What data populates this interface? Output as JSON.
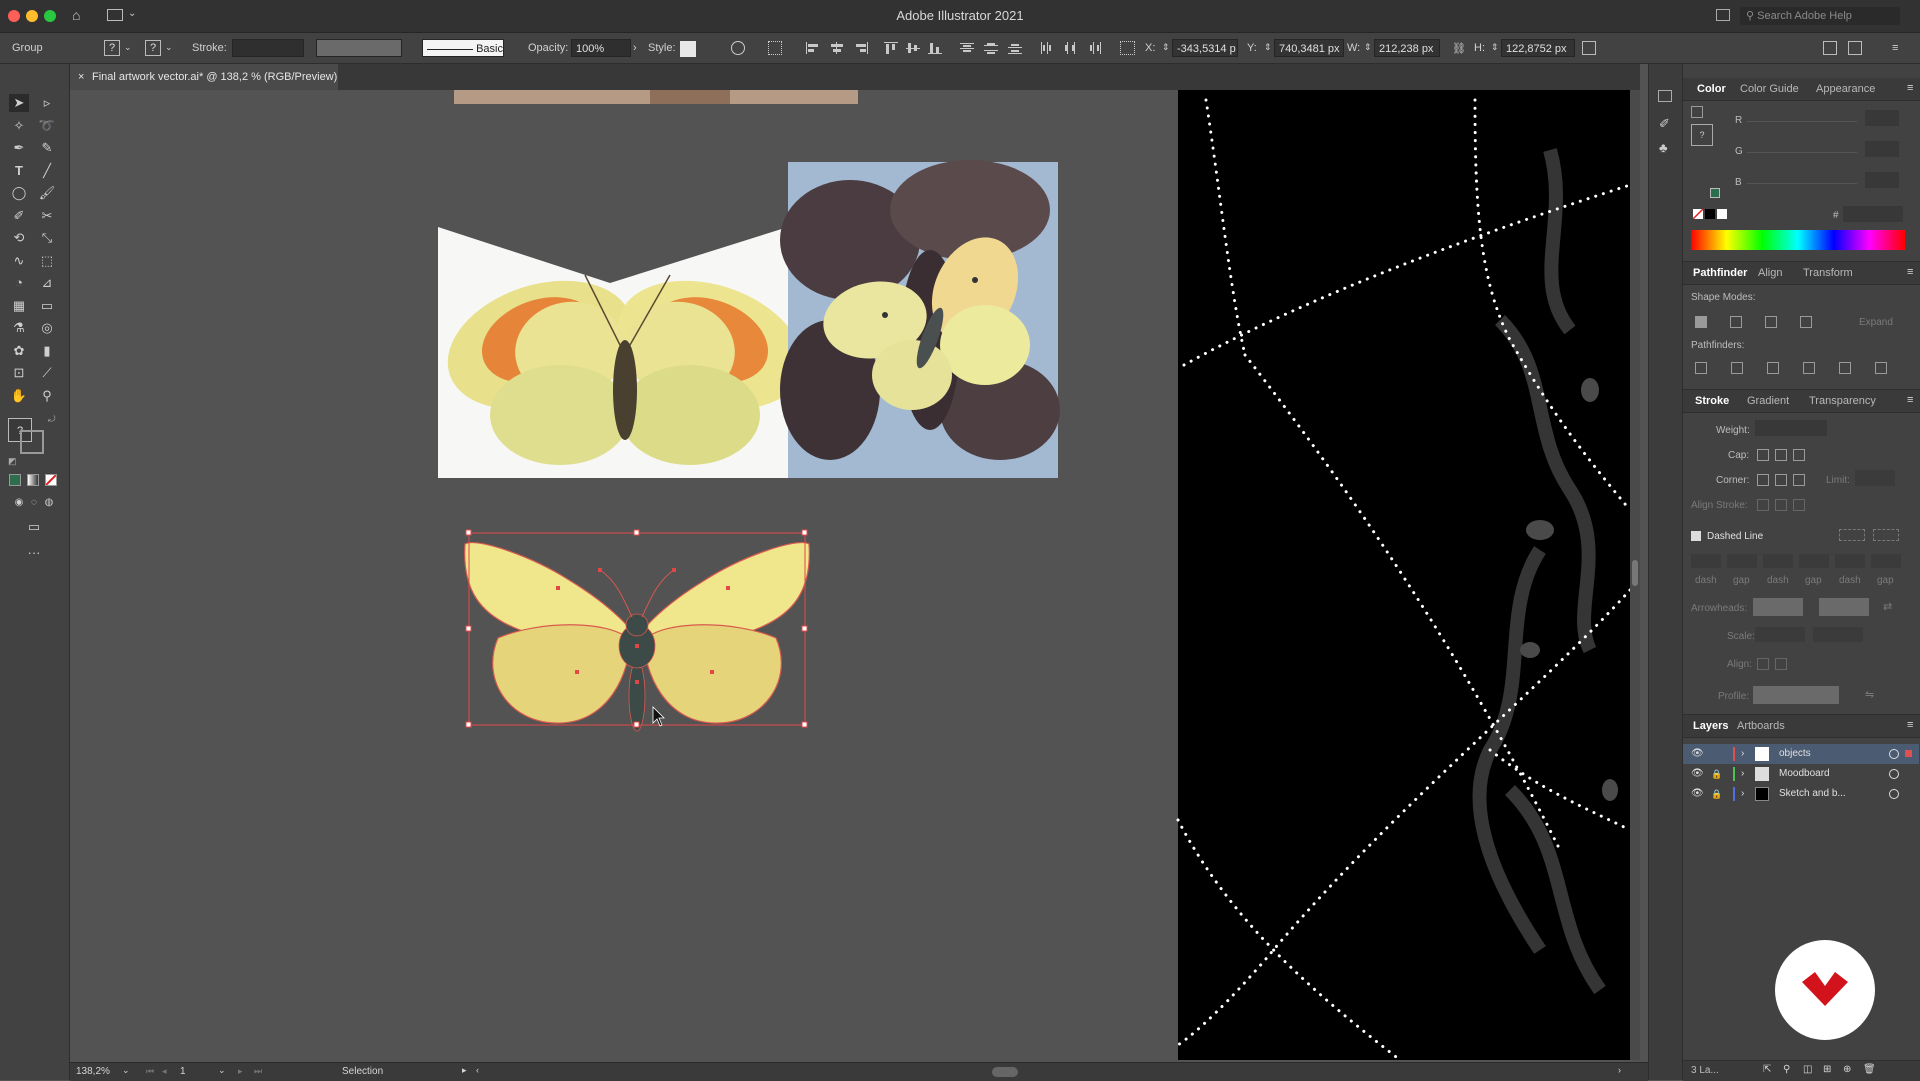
{
  "app": {
    "title": "Adobe Illustrator 2021",
    "search_placeholder": "Search Adobe Help"
  },
  "controlbar": {
    "selection_type": "Group",
    "stroke_label": "Stroke:",
    "brush_label": "Basic",
    "opacity_label": "Opacity:",
    "opacity_value": "100%",
    "style_label": "Style:",
    "x_label": "X:",
    "x_value": "-343,5314 p",
    "y_label": "Y:",
    "y_value": "740,3481 px",
    "w_label": "W:",
    "w_value": "212,238 px",
    "h_label": "H:",
    "h_value": "122,8752 px"
  },
  "document": {
    "tab_title": "Final artwork vector.ai* @ 138,2 % (RGB/Preview)"
  },
  "panels": {
    "color": {
      "tabs": [
        "Color",
        "Color Guide",
        "Appearance"
      ],
      "channels": [
        "R",
        "G",
        "B"
      ],
      "hex_label": "#"
    },
    "pathfinder": {
      "tabs": [
        "Pathfinder",
        "Align",
        "Transform"
      ],
      "shape_modes_label": "Shape Modes:",
      "pathfinders_label": "Pathfinders:",
      "expand_label": "Expand"
    },
    "stroke": {
      "tabs": [
        "Stroke",
        "Gradient",
        "Transparency"
      ],
      "weight_label": "Weight:",
      "cap_label": "Cap:",
      "corner_label": "Corner:",
      "limit_label": "Limit:",
      "align_stroke_label": "Align Stroke:",
      "dashed_label": "Dashed Line",
      "dash_labels": [
        "dash",
        "gap",
        "dash",
        "gap",
        "dash",
        "gap"
      ],
      "arrowheads_label": "Arrowheads:",
      "scale_label": "Scale:",
      "align_label": "Align:",
      "profile_label": "Profile:"
    },
    "layers": {
      "tabs": [
        "Layers",
        "Artboards"
      ],
      "items": [
        {
          "name": "objects",
          "color": "#e05050",
          "selected": true
        },
        {
          "name": "Moodboard",
          "color": "#50c050",
          "locked": true
        },
        {
          "name": "Sketch and b...",
          "color": "#5070e0",
          "locked": true
        }
      ],
      "count_label": "3 La..."
    }
  },
  "status": {
    "zoom": "138,2%",
    "artboard": "1",
    "tool": "Selection"
  },
  "colors": {
    "butterfly_fill": "#f0e68c",
    "butterfly_lower": "#e6d47a",
    "selection": "#e04848",
    "body": "#3c4a48"
  }
}
